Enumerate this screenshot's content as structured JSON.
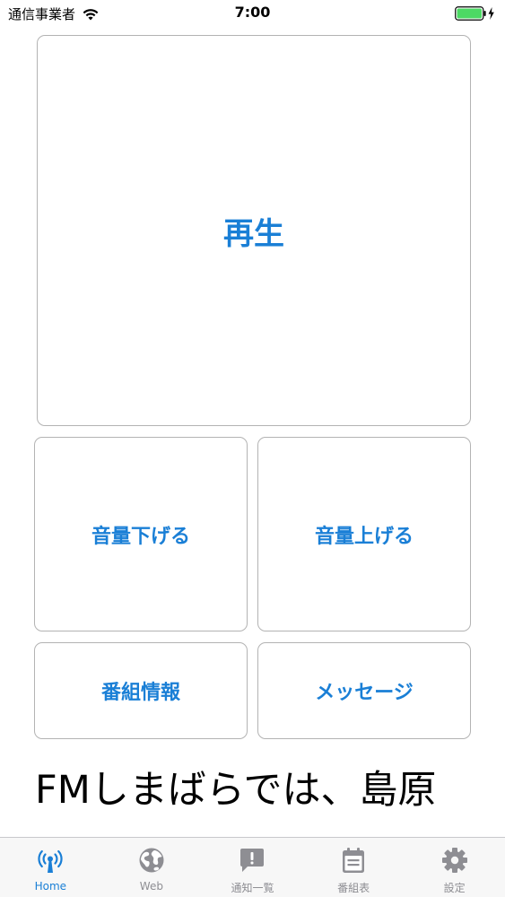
{
  "status_bar": {
    "carrier": "通信事業者",
    "time": "7:00"
  },
  "buttons": {
    "play": "再生",
    "volume_down": "音量下げる",
    "volume_up": "音量上げる",
    "program_info": "番組情報",
    "message": "メッセージ"
  },
  "marquee": {
    "text": "FMしまばらでは、島原"
  },
  "tabs": [
    {
      "label": "Home",
      "icon": "antenna-icon",
      "active": true
    },
    {
      "label": "Web",
      "icon": "globe-icon",
      "active": false
    },
    {
      "label": "通知一覧",
      "icon": "alert-bubble-icon",
      "active": false
    },
    {
      "label": "番組表",
      "icon": "calendar-icon",
      "active": false
    },
    {
      "label": "設定",
      "icon": "gear-icon",
      "active": false
    }
  ],
  "colors": {
    "accent": "#1a7fd6",
    "inactive": "#8e8e93",
    "battery": "#4cd964"
  }
}
